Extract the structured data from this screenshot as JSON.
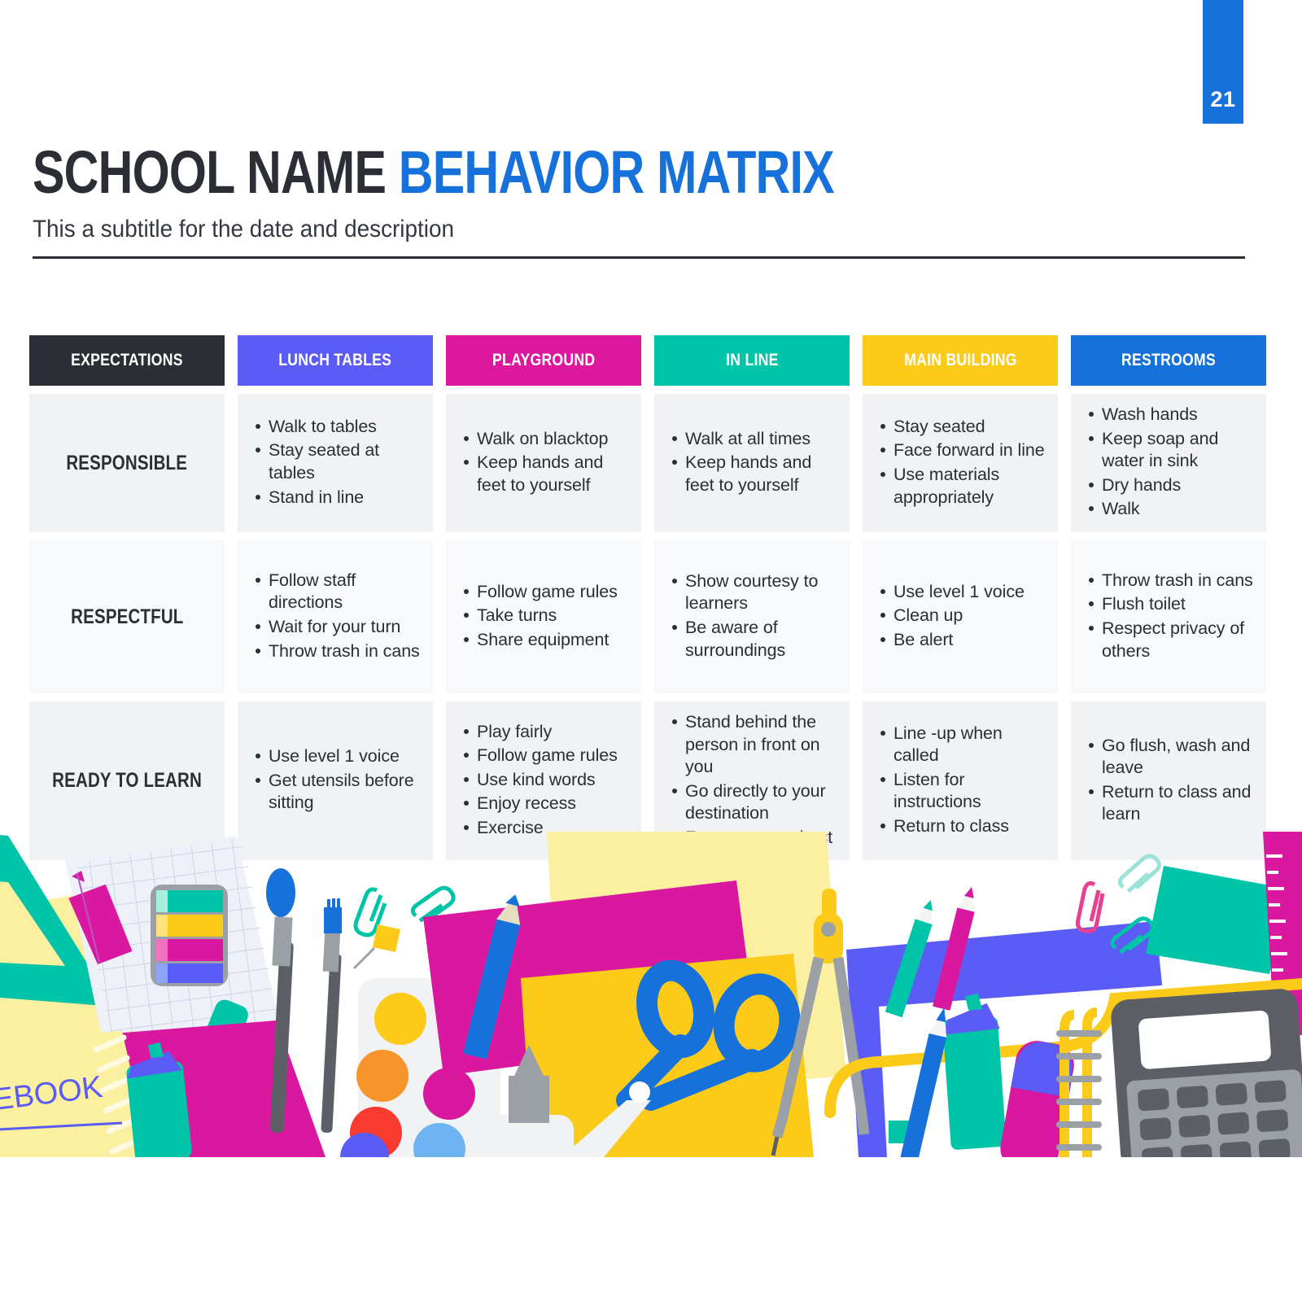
{
  "page": {
    "number": "21",
    "badge_color": "#1671DB"
  },
  "header": {
    "title_dark": "SCHOOL NAME",
    "title_accent": "BEHAVIOR MATRIX",
    "subtitle": "This a subtitle for the date and description"
  },
  "matrix": {
    "columns": [
      {
        "label": "EXPECTATIONS",
        "color": "#2B2E35"
      },
      {
        "label": "LUNCH TABLES",
        "color": "#5B5BF5"
      },
      {
        "label": "PLAYGROUND",
        "color": "#DD189F"
      },
      {
        "label": "IN LINE",
        "color": "#00C4A7"
      },
      {
        "label": "MAIN BUILDING",
        "color": "#FCCB1A"
      },
      {
        "label": "RESTROOMS",
        "color": "#1671DB"
      }
    ],
    "rows": [
      {
        "label": "RESPONSIBLE",
        "cells": [
          [
            "Walk to tables",
            "Stay seated at tables",
            "Stand in line"
          ],
          [
            "Walk on blacktop",
            "Keep hands and feet to yourself"
          ],
          [
            "Walk at all times",
            "Keep hands and feet to yourself"
          ],
          [
            "Stay seated",
            "Face forward in line",
            "Use materials appropriately"
          ],
          [
            "Wash hands",
            "Keep soap and water in sink",
            "Dry hands",
            "Walk"
          ]
        ]
      },
      {
        "label": "RESPECTFUL",
        "cells": [
          [
            "Follow staff directions",
            "Wait for your turn",
            "Throw trash in cans"
          ],
          [
            "Follow game rules",
            "Take turns",
            "Share equipment"
          ],
          [
            "Show courtesy to learners",
            "Be aware of surroundings"
          ],
          [
            "Use level 1 voice",
            "Clean up",
            "Be alert"
          ],
          [
            "Throw trash in cans",
            "Flush toilet",
            "Respect privacy of others"
          ]
        ]
      },
      {
        "label": "READY TO LEARN",
        "cells": [
          [
            "Use level 1 voice",
            "Get utensils before sitting"
          ],
          [
            "Play fairly",
            "Follow game rules",
            "Use kind words",
            "Enjoy recess",
            "Exercise"
          ],
          [
            "Stand behind the person in front on you",
            "Go directly to your destination",
            "Focus on your best"
          ],
          [
            "Line -up when called",
            "Listen for instructions",
            "Return to class"
          ],
          [
            "Go flush, wash and leave",
            "Return to class and learn"
          ]
        ]
      }
    ]
  },
  "illustration": {
    "notebook_label": "TEBOOK",
    "palette": {
      "magenta": "#D9189F",
      "teal": "#00C4A7",
      "yellow": "#FCCB1A",
      "pale_yellow": "#FBEFA0",
      "blue": "#1671DB",
      "purple": "#5B5BF5",
      "orange": "#F7952B",
      "red": "#F93A2F",
      "light_blue": "#6FB4F2",
      "grey": "#9AA0A6",
      "dark_grey": "#5C6066",
      "paper": "#EEF1F8"
    }
  }
}
